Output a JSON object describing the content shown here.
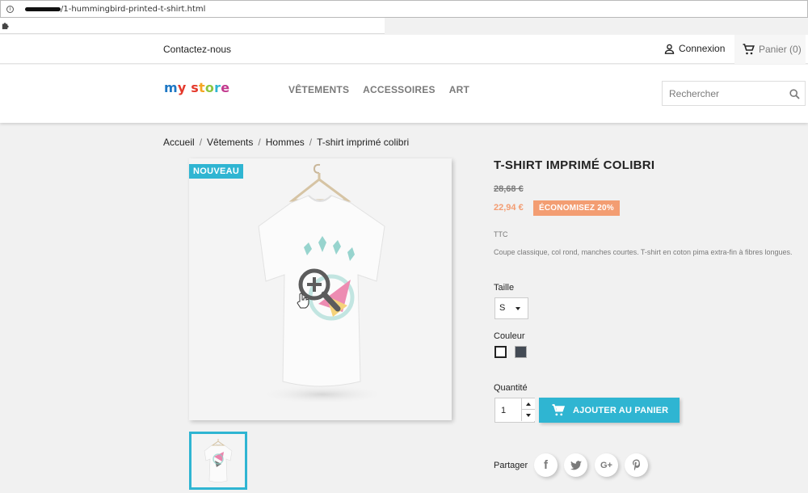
{
  "browser": {
    "url": "/1-hummingbird-printed-t-shirt.html"
  },
  "header": {
    "contact": "Contactez-nous",
    "login": "Connexion",
    "cart": "Panier (0)",
    "logo": [
      "m",
      "y",
      " ",
      "s",
      "t",
      "o",
      "r",
      "e"
    ],
    "logo_colors": [
      "#1d77c4",
      "#e4392c",
      "#ffffff",
      "#e4392c",
      "#f5a623",
      "#8cc63f",
      "#2fb5d2",
      "#c23a8e"
    ],
    "menu": [
      "VÊTEMENTS",
      "ACCESSOIRES",
      "ART"
    ],
    "search_placeholder": "Rechercher"
  },
  "breadcrumb": [
    "Accueil",
    "Vêtements",
    "Hommes",
    "T-shirt imprimé colibri"
  ],
  "product": {
    "badge": "NOUVEAU",
    "title": "T-SHIRT IMPRIMÉ COLIBRI",
    "regular_price": "28,68 €",
    "price": "22,94 €",
    "discount": "ÉCONOMISEZ 20%",
    "tax": "TTC",
    "description": "Coupe classique, col rond, manches courtes. T-shirt en coton pima extra-fin à fibres longues.",
    "size_label": "Taille",
    "size_value": "S",
    "color_label": "Couleur",
    "colors": [
      "#ffffff",
      "#434a54"
    ],
    "quantity_label": "Quantité",
    "quantity": "1",
    "add_to_cart": "AJOUTER AU PANIER",
    "share_label": "Partager",
    "social": [
      "f",
      "t",
      "G+",
      "P"
    ]
  },
  "colors": {
    "accent": "#2fb5d2",
    "discount": "#f39d72"
  }
}
